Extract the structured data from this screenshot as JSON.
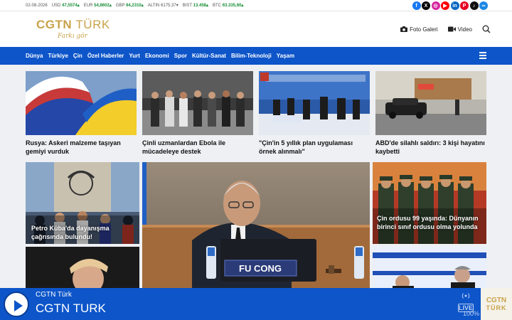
{
  "ticker": {
    "date": "02-08-2026",
    "items": [
      {
        "label": "USD",
        "value": "47,5574"
      },
      {
        "label": "EUR",
        "value": "54,8602"
      },
      {
        "label": "GBP",
        "value": "64,2310"
      },
      {
        "label": "ALTIN",
        "value": "6175.37"
      },
      {
        "label": "BIST",
        "value": "13.458"
      },
      {
        "label": "BTC",
        "value": "63.335,60"
      }
    ]
  },
  "social": [
    {
      "icon": "facebook-icon",
      "glyph": "f",
      "color": "#1877f2"
    },
    {
      "icon": "x-icon",
      "glyph": "X",
      "color": "#000000"
    },
    {
      "icon": "instagram-icon",
      "glyph": "◎",
      "color": "#d6249f"
    },
    {
      "icon": "youtube-icon",
      "glyph": "▶",
      "color": "#ff0000"
    },
    {
      "icon": "linkedin-icon",
      "glyph": "in",
      "color": "#0a66c2"
    },
    {
      "icon": "pinterest-icon",
      "glyph": "P",
      "color": "#e60023"
    },
    {
      "icon": "tiktok-icon",
      "glyph": "♪",
      "color": "#111111"
    },
    {
      "icon": "link-icon",
      "glyph": "∞",
      "color": "#1e88e5"
    }
  ],
  "logo": {
    "brand": "CGTN",
    "brand_light": "TÜRK",
    "slogan": "Farkı gör"
  },
  "header": {
    "photo_gallery": "Foto Galeri",
    "video": "Video"
  },
  "nav": [
    "Dünya",
    "Türkiye",
    "Çin",
    "Özel Haberler",
    "Yurt",
    "Ekonomi",
    "Spor",
    "Kültür-Sanat",
    "Bilim-Teknoloji",
    "Yaşam"
  ],
  "top_news": [
    {
      "caption": "Rusya: Askeri malzeme taşıyan gemiyi vurduk"
    },
    {
      "caption": "Çinli uzmanlardan Ebola ile mücadeleye destek"
    },
    {
      "caption": "\"Çin'in 5 yıllık plan uygulaması örnek alınmalı\""
    },
    {
      "caption": "ABD'de silahlı saldırı: 3 kişi hayatını kaybetti"
    }
  ],
  "left_story": {
    "caption": "Petro Küba'da dayanışma çağrısında bulundu!"
  },
  "center_story": {
    "nameplate": "FU CONG"
  },
  "right_story": {
    "caption": "Çin ordusu 99 yaşında: Dünyanın birinci sınıf ordusu olma yolunda"
  },
  "colors": {
    "brand_blue": "#0d55c9",
    "gold": "#c9a34a",
    "up": "#1a8f3a"
  },
  "player": {
    "station_sub": "CGTN Türk",
    "station": "CGTN TURK",
    "volume": "100%",
    "live": "LIVE",
    "logo_top": "CGTN",
    "logo_bottom": "TÜRK"
  }
}
